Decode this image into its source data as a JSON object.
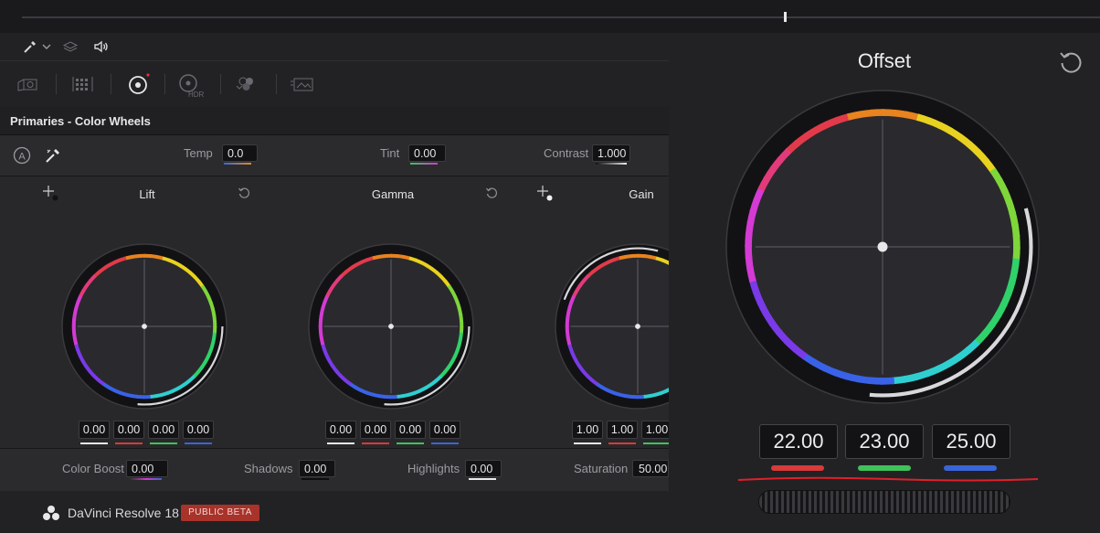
{
  "toolbar": {
    "icons": [
      "eyedropper-icon",
      "chevron-down-icon",
      "layers-icon",
      "speaker-icon"
    ],
    "palette_icons": [
      "camera-raw-icon",
      "color-match-icon",
      "color-wheels-icon",
      "hdr-icon",
      "rgb-mixer-icon",
      "motion-effects-icon"
    ],
    "hdr_label": "HDR"
  },
  "section": {
    "title": "Primaries - Color Wheels"
  },
  "params": {
    "temp": {
      "label": "Temp",
      "value": "0.0"
    },
    "tint": {
      "label": "Tint",
      "value": "0.00"
    },
    "contrast": {
      "label": "Contrast",
      "value": "1.000"
    }
  },
  "wheels": [
    {
      "name": "Lift",
      "values": [
        "0.00",
        "0.00",
        "0.00",
        "0.00"
      ]
    },
    {
      "name": "Gamma",
      "values": [
        "0.00",
        "0.00",
        "0.00",
        "0.00"
      ]
    },
    {
      "name": "Gain",
      "values": [
        "1.00",
        "1.00",
        "1.00"
      ]
    }
  ],
  "bottom_params": {
    "color_boost": {
      "label": "Color Boost",
      "value": "0.00"
    },
    "shadows": {
      "label": "Shadows",
      "value": "0.00"
    },
    "highlights": {
      "label": "Highlights",
      "value": "0.00"
    },
    "saturation": {
      "label": "Saturation",
      "value": "50.00"
    }
  },
  "footer": {
    "app_name": "DaVinci Resolve 18",
    "badge": "PUBLIC BETA"
  },
  "offset": {
    "title": "Offset",
    "values": [
      "22.00",
      "23.00",
      "25.00"
    ]
  },
  "colors": {
    "red": "#d93a3a",
    "green": "#3fc25a",
    "blue": "#3a64d9",
    "white": "#e6e6e6",
    "annotation": "#e0202a",
    "badge": "#a8332a"
  }
}
